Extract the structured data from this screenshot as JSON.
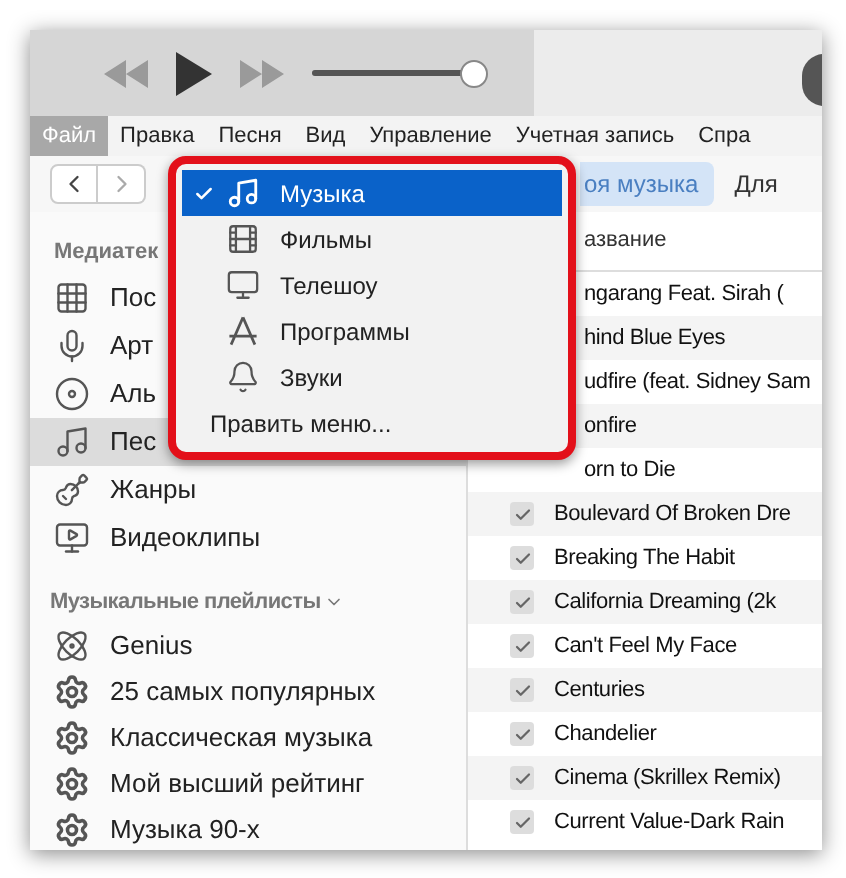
{
  "player": {
    "volume": {
      "level": 1
    }
  },
  "menu_bar": [
    {
      "label": "Файл",
      "selected": true
    },
    {
      "label": "Правка",
      "selected": false
    },
    {
      "label": "Песня",
      "selected": false
    },
    {
      "label": "Вид",
      "selected": false
    },
    {
      "label": "Управление",
      "selected": false
    },
    {
      "label": "Учетная запись",
      "selected": false
    },
    {
      "label": "Спра",
      "selected": false
    }
  ],
  "nav_tabs": [
    {
      "label": "оя музыка",
      "selected": true
    },
    {
      "label": "Для",
      "selected": false
    }
  ],
  "sidebar": {
    "library_header": "Медиатек",
    "library_items": [
      {
        "label": "Пос",
        "selected": false
      },
      {
        "label": "Арт",
        "selected": false
      },
      {
        "label": "Аль",
        "selected": false
      },
      {
        "label": "Пес",
        "selected": true
      },
      {
        "label": "Жанры",
        "selected": false
      },
      {
        "label": "Видеоклипы",
        "selected": false
      }
    ],
    "playlists_header": "Музыкальные плейлисты",
    "playlists": [
      {
        "label": "Genius",
        "kind": "genius"
      },
      {
        "label": "25 самых популярных",
        "kind": "smart"
      },
      {
        "label": "Классическая музыка",
        "kind": "smart"
      },
      {
        "label": "Мой высший рейтинг",
        "kind": "smart"
      },
      {
        "label": "Музыка 90-х",
        "kind": "smart"
      }
    ]
  },
  "table": {
    "columns": [
      "азвание"
    ],
    "rows": [
      {
        "title": "ngarang Feat. Sirah (",
        "kind": "covered"
      },
      {
        "title": "hind Blue Eyes",
        "kind": "covered"
      },
      {
        "title": "udfire (feat. Sidney Sam",
        "kind": "covered"
      },
      {
        "title": "onfire",
        "kind": "covered"
      },
      {
        "title": "orn to Die",
        "kind": "covered"
      },
      {
        "title": "Boulevard Of Broken Dre",
        "kind": "check",
        "checked": true
      },
      {
        "title": "Breaking The Habit",
        "kind": "check",
        "checked": true
      },
      {
        "title": "California Dreaming (2k",
        "kind": "check",
        "checked": true
      },
      {
        "title": "Can't Feel My Face",
        "kind": "check",
        "checked": true
      },
      {
        "title": "Centuries",
        "kind": "check",
        "checked": true
      },
      {
        "title": "Chandelier",
        "kind": "check",
        "checked": true
      },
      {
        "title": "Cinema (Skrillex Remix)",
        "kind": "check",
        "checked": true
      },
      {
        "title": "Current Value-Dark Rain",
        "kind": "check",
        "checked": true
      }
    ]
  },
  "dropdown": {
    "items": [
      {
        "label": "Музыка",
        "selected": true
      },
      {
        "label": "Фильмы",
        "selected": false
      },
      {
        "label": "Телешоу",
        "selected": false
      },
      {
        "label": "Программы",
        "selected": false
      },
      {
        "label": "Звуки",
        "selected": false
      }
    ],
    "edit_item": "Править меню..."
  }
}
